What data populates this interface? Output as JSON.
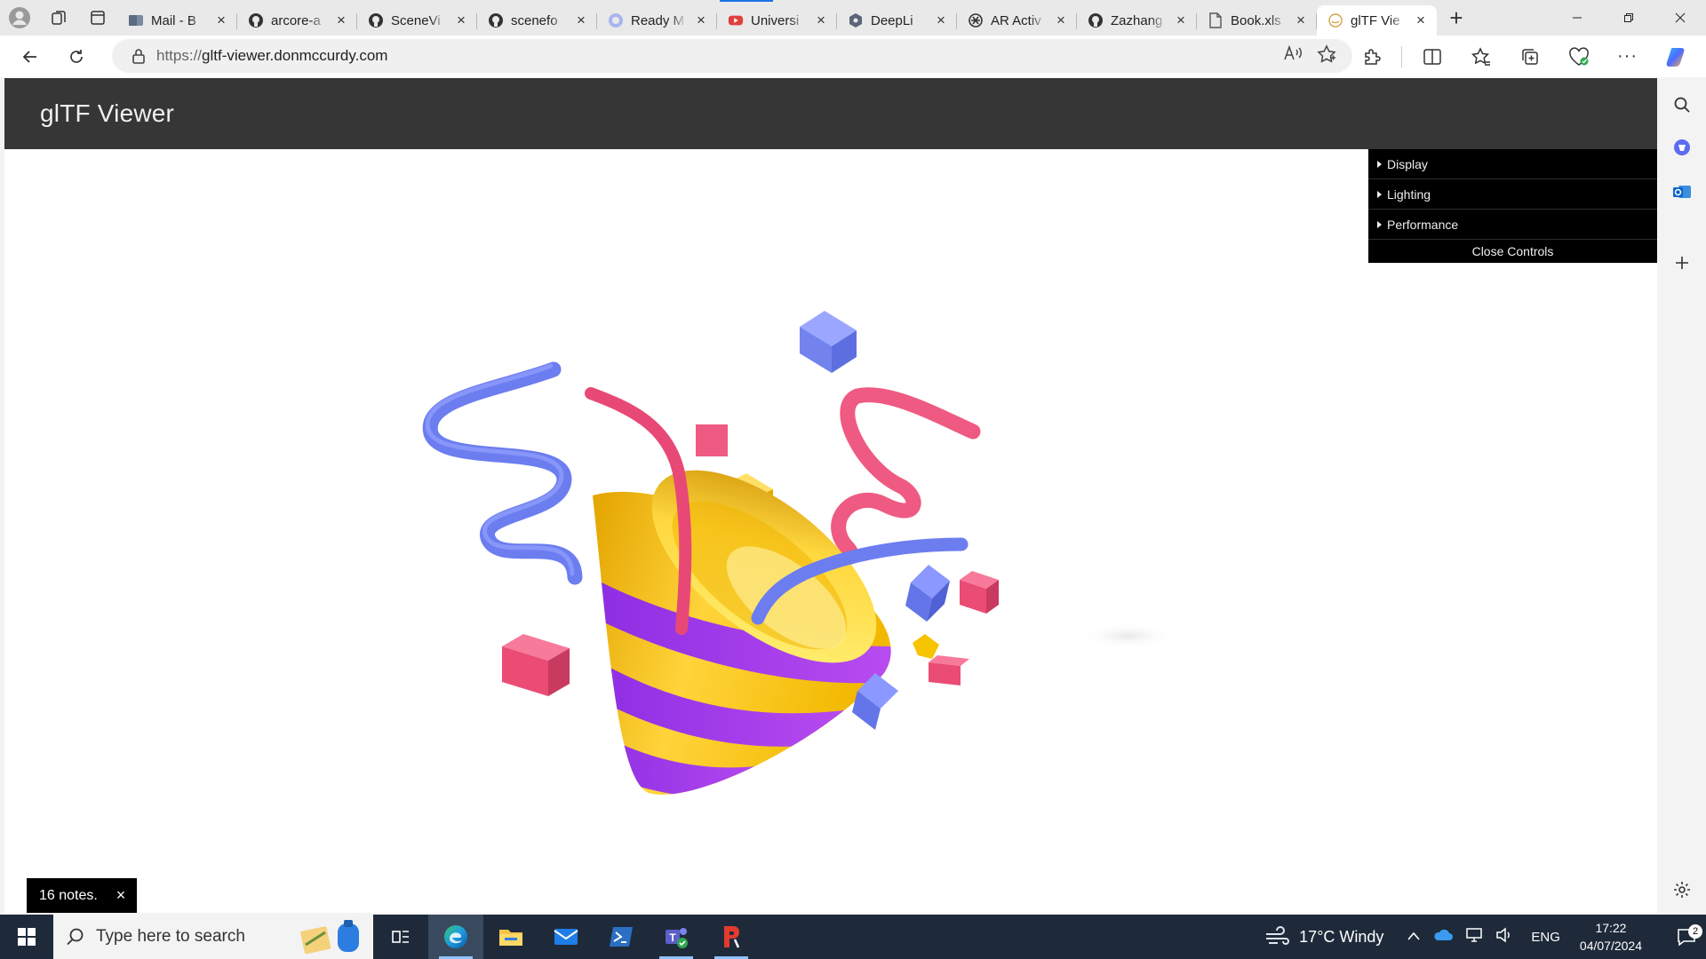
{
  "browser": {
    "tabs": [
      {
        "title": "Mail - B",
        "icon": "outlook-icon"
      },
      {
        "title": "arcore-a",
        "icon": "github-icon"
      },
      {
        "title": "SceneVi",
        "icon": "github-icon"
      },
      {
        "title": "scenefo",
        "icon": "github-icon"
      },
      {
        "title": "Ready M",
        "icon": "globe-icon"
      },
      {
        "title": "Universi",
        "icon": "youtube-icon"
      },
      {
        "title": "DeepLi",
        "icon": "deepl-icon"
      },
      {
        "title": "AR Activ",
        "icon": "chatgpt-icon"
      },
      {
        "title": "Zazhang",
        "icon": "github-icon"
      },
      {
        "title": "Book.xls",
        "icon": "file-icon"
      },
      {
        "title": "glTF Vie",
        "icon": "gltf-icon",
        "active": true
      }
    ],
    "url_scheme": "https://",
    "url_host": "gltf-viewer.donmccurdy.com"
  },
  "app": {
    "title": "glTF Viewer"
  },
  "controls": {
    "folders": [
      "Display",
      "Lighting",
      "Performance"
    ],
    "close_label": "Close Controls"
  },
  "notes": {
    "label": "16 notes.",
    "close": "×"
  },
  "taskbar": {
    "search_placeholder": "Type here to search",
    "weather": "17°C  Windy",
    "language": "ENG",
    "time": "17:22",
    "date": "04/07/2024",
    "notification_count": "2"
  },
  "colors": {
    "header_bg": "#363636",
    "controls_bg": "#000000",
    "accent": "#1a73e8"
  }
}
